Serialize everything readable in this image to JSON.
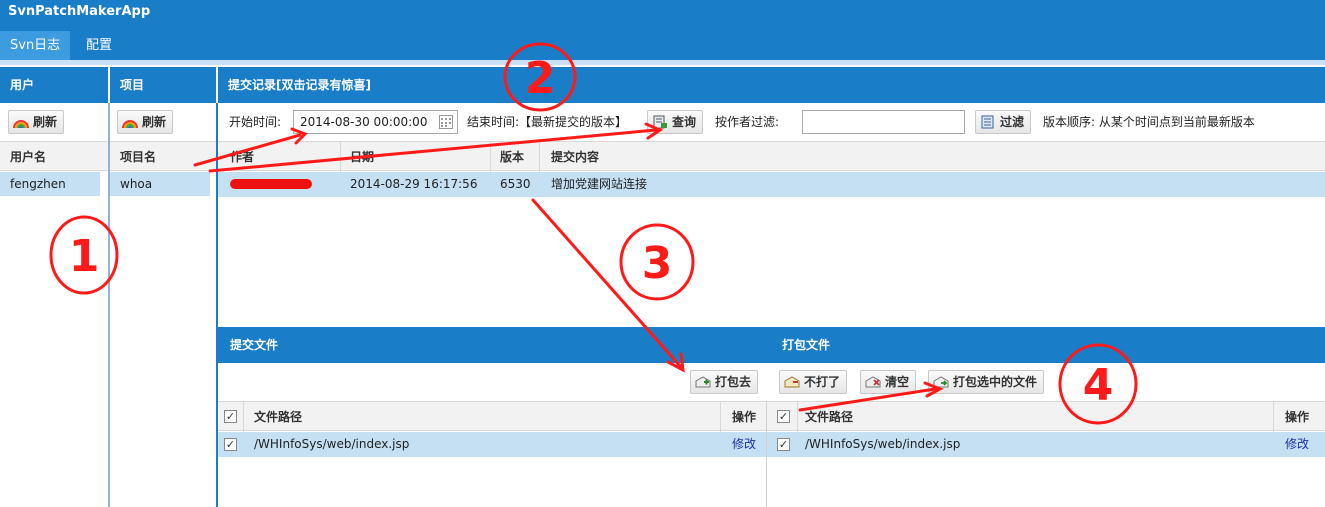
{
  "app": {
    "title": "SvnPatchMakerApp"
  },
  "tabs": [
    {
      "label": "Svn日志"
    },
    {
      "label": "配置"
    }
  ],
  "users_panel": {
    "title": "用户",
    "refresh_label": "刷新",
    "column": "用户名",
    "items": [
      "fengzhen"
    ]
  },
  "projects_panel": {
    "title": "项目",
    "refresh_label": "刷新",
    "column": "项目名",
    "items": [
      "whoa"
    ]
  },
  "commits_panel": {
    "title": "提交记录[双击记录有惊喜]",
    "start_label": "开始时间:",
    "start_value": "2014-08-30 00:00:00",
    "end_label": "结束时间:【最新提交的版本】",
    "query_label": "查询",
    "author_filter_label": "按作者过滤:",
    "author_filter_value": "",
    "filter_label": "过滤",
    "order_label": "版本顺序: 从某个时间点到当前最新版本",
    "columns": [
      "作者",
      "日期",
      "版本",
      "提交内容"
    ],
    "rows": [
      {
        "author": "",
        "date": "2014-08-29 16:17:56",
        "revision": "6530",
        "message": "增加党建网站连接"
      }
    ]
  },
  "commit_files": {
    "title": "提交文件",
    "columns": [
      "文件路径",
      "操作"
    ],
    "rows": [
      {
        "path": "/WHInfoSys/web/index.jsp",
        "action": "修改"
      }
    ]
  },
  "package_files": {
    "title": "打包文件",
    "columns": [
      "文件路径",
      "操作"
    ],
    "rows": [
      {
        "path": "/WHInfoSys/web/index.jsp",
        "action": "修改"
      }
    ]
  },
  "toolbar": {
    "package_to": "打包去",
    "exclude": "不打了",
    "clear": "清空",
    "package_selected": "打包选中的文件"
  },
  "annotations": {
    "n1": "1",
    "n2": "2",
    "n3": "3",
    "n4": "4"
  },
  "colors": {
    "header_blue": "#1a7dc7",
    "selected_row": "#c5dff3",
    "annotation_red": "#ff1a1a"
  }
}
